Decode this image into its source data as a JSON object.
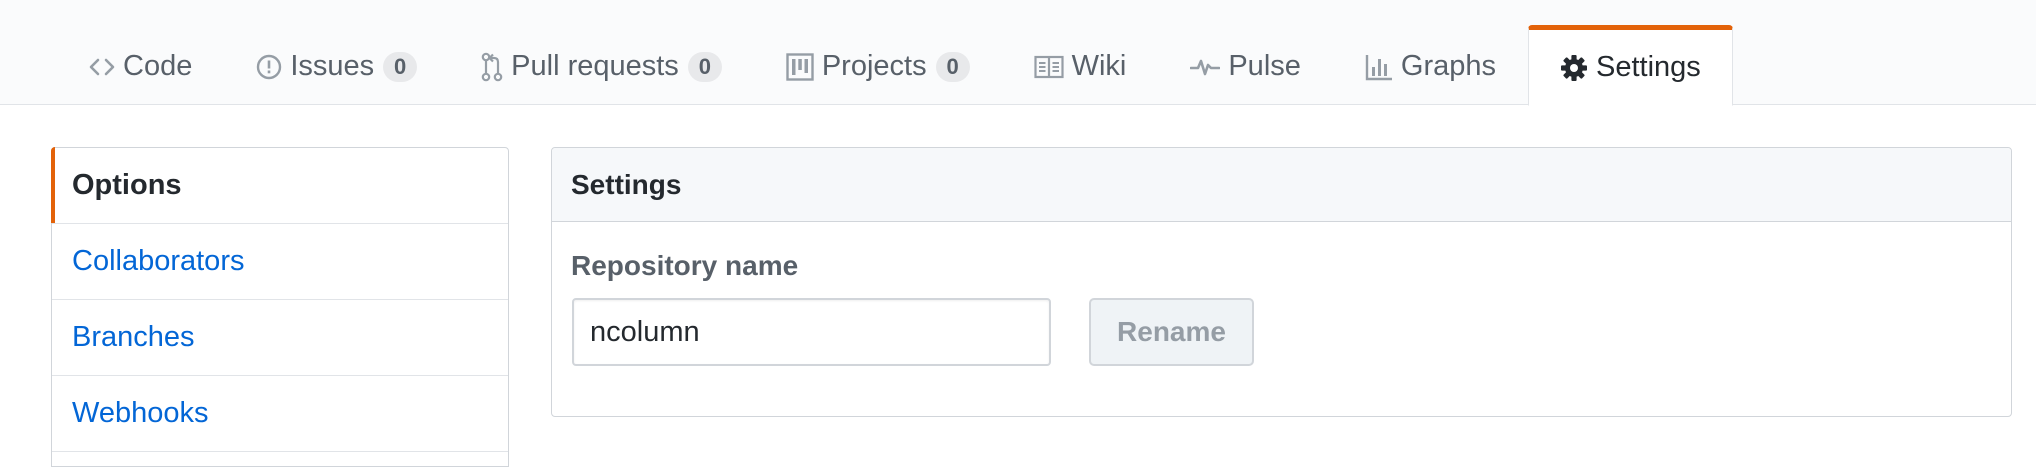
{
  "repo_nav": {
    "tabs": [
      {
        "label": "Code",
        "icon": "code-icon",
        "counter": null,
        "selected": false
      },
      {
        "label": "Issues",
        "icon": "issue-icon",
        "counter": "0",
        "selected": false
      },
      {
        "label": "Pull requests",
        "icon": "pull-request-icon",
        "counter": "0",
        "selected": false
      },
      {
        "label": "Projects",
        "icon": "project-icon",
        "counter": "0",
        "selected": false
      },
      {
        "label": "Wiki",
        "icon": "book-icon",
        "counter": null,
        "selected": false
      },
      {
        "label": "Pulse",
        "icon": "pulse-icon",
        "counter": null,
        "selected": false
      },
      {
        "label": "Graphs",
        "icon": "graph-icon",
        "counter": null,
        "selected": false
      },
      {
        "label": "Settings",
        "icon": "gear-icon",
        "counter": null,
        "selected": true
      }
    ]
  },
  "sidebar": {
    "items": [
      {
        "label": "Options",
        "selected": true
      },
      {
        "label": "Collaborators",
        "selected": false
      },
      {
        "label": "Branches",
        "selected": false
      },
      {
        "label": "Webhooks",
        "selected": false
      }
    ]
  },
  "settings_box": {
    "title": "Settings",
    "repository_name_label": "Repository name",
    "repository_name_value": "ncolumn",
    "rename_label": "Rename"
  },
  "colors": {
    "accent": "#e36209",
    "link": "#0366d6",
    "text": "#24292e",
    "muted": "#586069",
    "border": "#d1d5da"
  }
}
